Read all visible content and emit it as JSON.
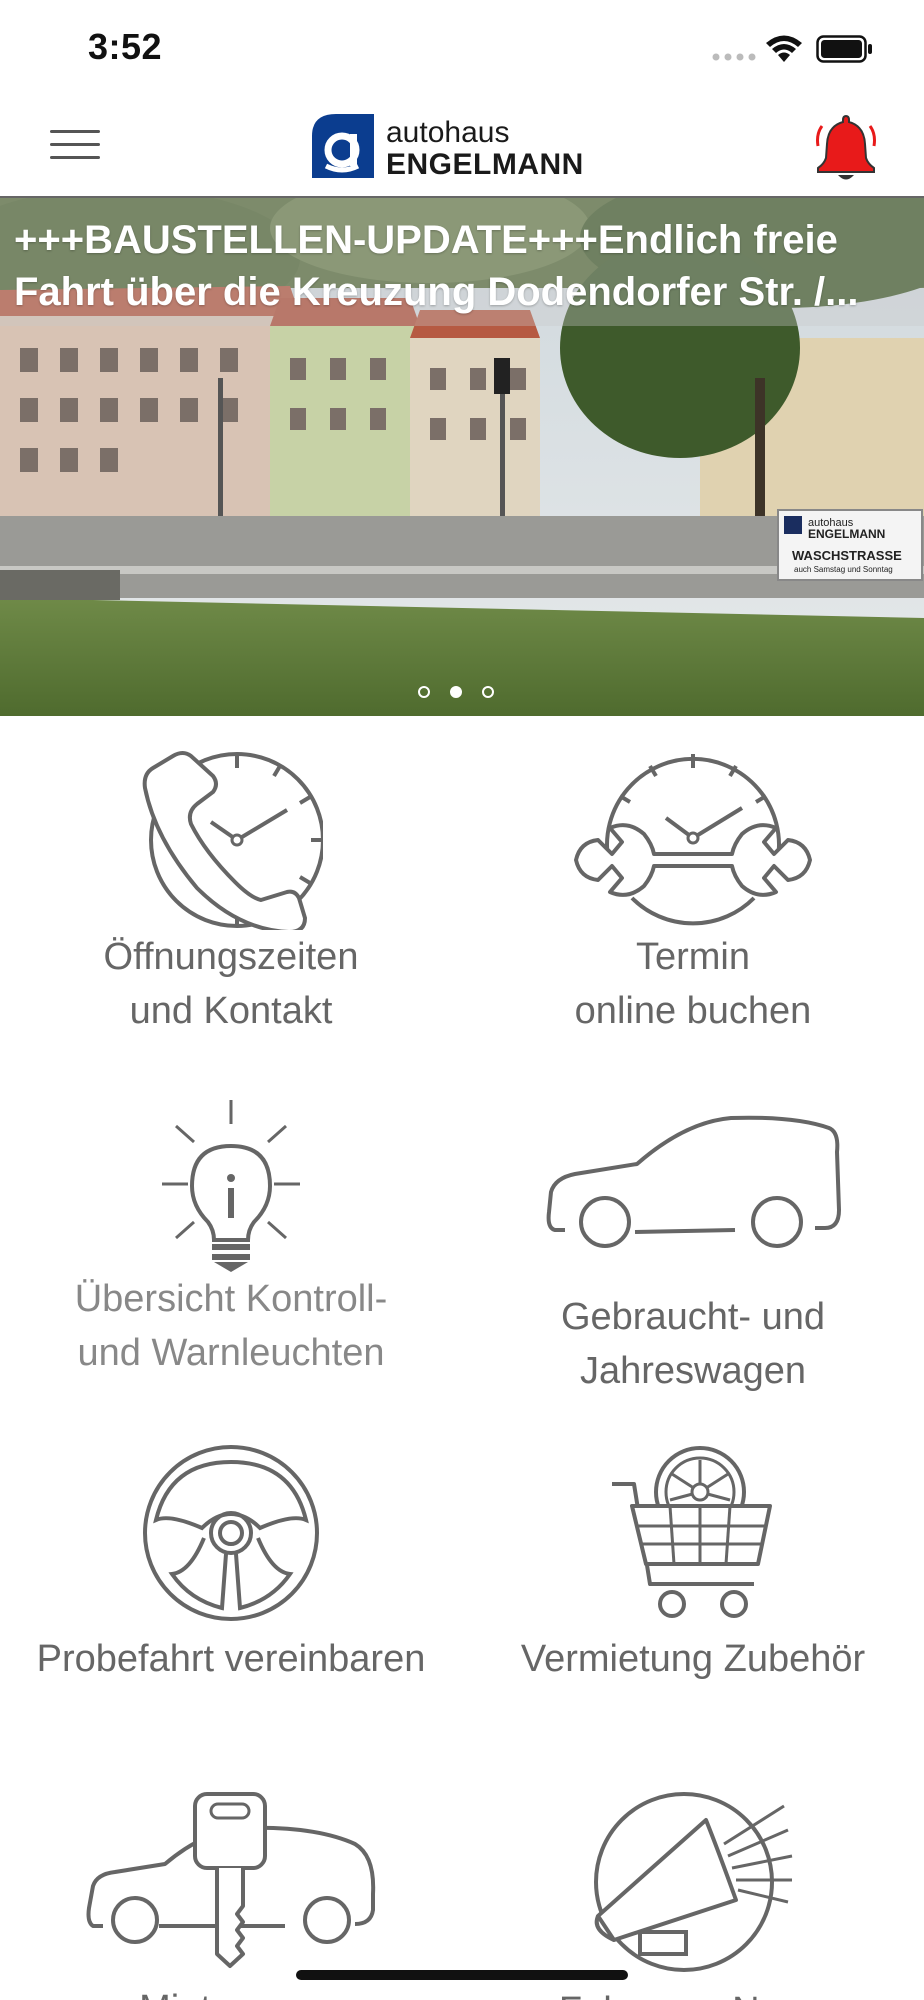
{
  "status": {
    "time": "3:52"
  },
  "header": {
    "logo_small": "autohaus",
    "logo_big": "ENGELMANN",
    "accent": "#0b3d8f",
    "bell_color": "#e81a1a"
  },
  "hero": {
    "caption": "+++BAUSTELLEN-UPDATE+++Endlich freie\nFahrt über die Kreuzung Dodendorfer Str. /...",
    "sign_small": "autohaus",
    "sign_big": "ENGELMANN",
    "sign_line1": "WASCHSTRASSE",
    "sign_line2": "auch Samstag und Sonntag",
    "dots_count": 3,
    "active_dot": 2
  },
  "tiles": [
    {
      "label1": "Öffnungszeiten",
      "label2": "und Kontakt",
      "icon": "clock-phone-icon"
    },
    {
      "label1": "Termin",
      "label2": "online buchen",
      "icon": "clock-wrench-icon"
    },
    {
      "label1": "Übersicht Kontroll-",
      "label2": "und Warnleuchten",
      "icon": "lightbulb-info-icon"
    },
    {
      "label1": "Gebraucht- und",
      "label2": "Jahreswagen",
      "icon": "car-icon"
    },
    {
      "label1": "Probefahrt vereinbaren",
      "label2": "",
      "icon": "steering-wheel-icon"
    },
    {
      "label1": "Vermietung Zubehör",
      "label2": "",
      "icon": "cart-rim-icon"
    },
    {
      "label1": "Mietwagen",
      "label2": "",
      "icon": "car-key-icon"
    },
    {
      "label1": "Fahrzeug-News",
      "label2": "",
      "icon": "megaphone-icon"
    }
  ]
}
